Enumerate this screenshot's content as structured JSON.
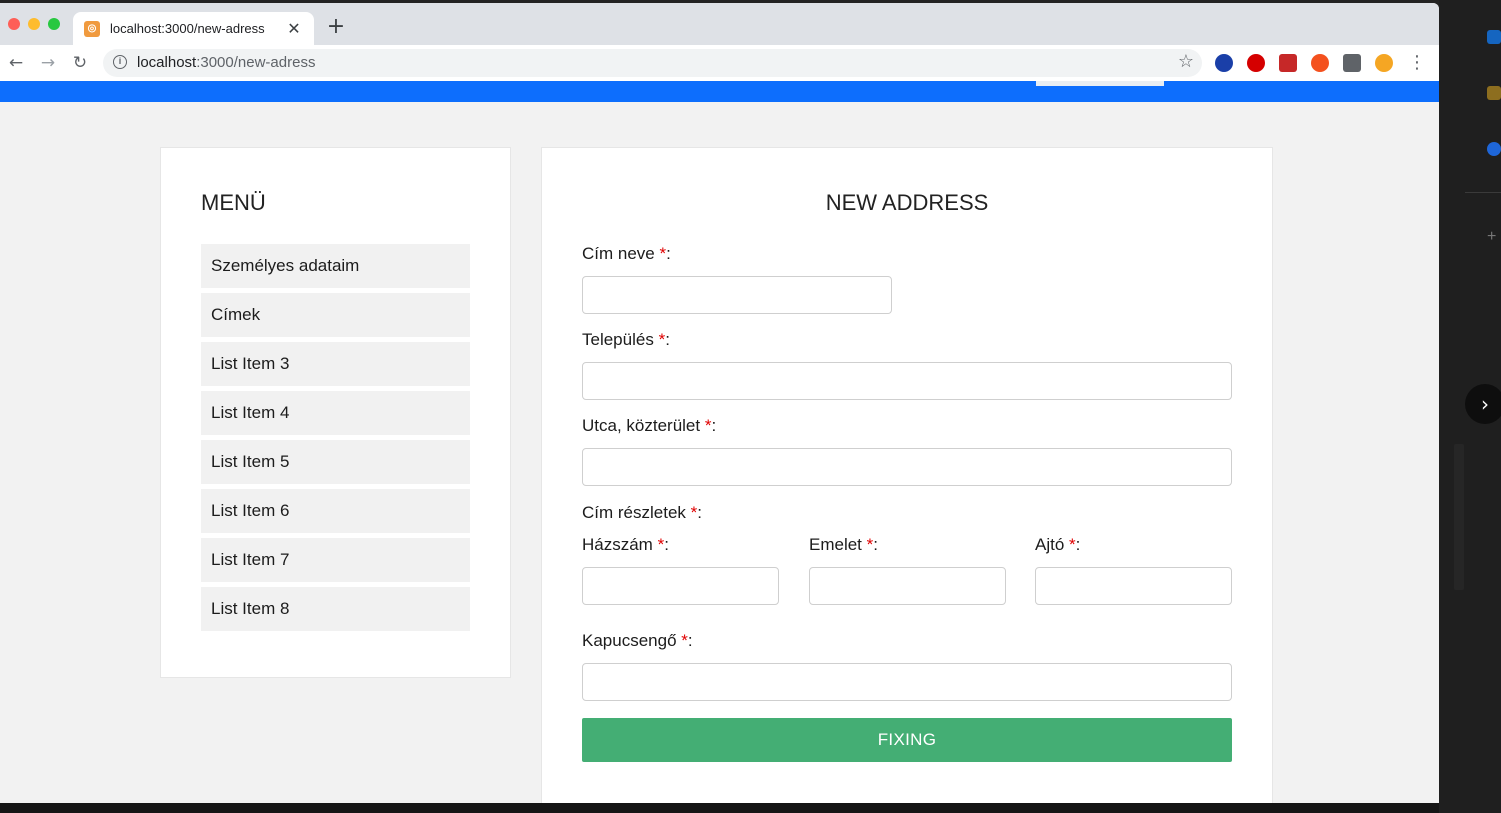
{
  "browser": {
    "tab_title": "localhost:3000/new-adress",
    "favicon_char": "◎",
    "new_tab": "+",
    "url_host": "localhost",
    "url_path": ":3000/new-adress",
    "back": "←",
    "forward": "→",
    "reload": "↻",
    "bookmark": "☆",
    "menu": "⋮",
    "extensions": [
      {
        "name": "ext-blue-icon",
        "color": "#1a3fa8"
      },
      {
        "name": "ext-red-icon",
        "color": "#d50000"
      },
      {
        "name": "ext-grid-icon",
        "color": "#c62828"
      },
      {
        "name": "ext-flame-icon",
        "color": "#f4511e"
      },
      {
        "name": "puzzle-icon",
        "color": "#5f6368"
      },
      {
        "name": "ext-orange-icon",
        "color": "#f5a623"
      }
    ]
  },
  "menu": {
    "title": "MENÜ",
    "items": [
      "Személyes adataim",
      "Címek",
      "List Item 3",
      "List Item 4",
      "List Item 5",
      "List Item 6",
      "List Item 7",
      "List Item 8"
    ]
  },
  "form": {
    "title": "NEW ADDRESS",
    "required_mark": "*",
    "colon": ":",
    "fields": {
      "address_name": "Cím neve",
      "city": "Település",
      "street": "Utca, közterület",
      "details": "Cím részletek",
      "house_number": "Házszám",
      "floor": "Emelet",
      "door": "Ajtó",
      "doorbell": "Kapucsengő"
    },
    "submit_label": "FIXING"
  },
  "side_arrow": "›",
  "colors": {
    "topbar": "#0d6efd",
    "submit": "#44ae74",
    "required": "#e00000"
  }
}
